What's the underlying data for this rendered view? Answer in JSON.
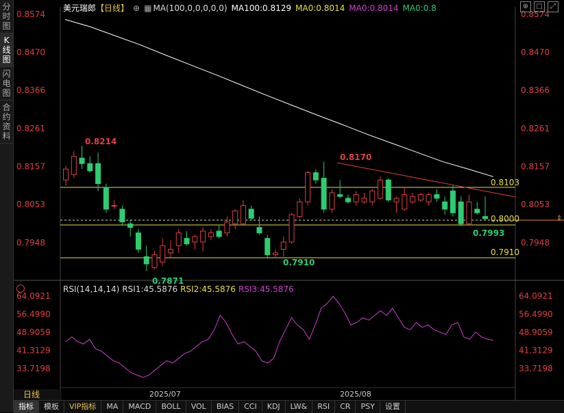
{
  "sidebar": {
    "tabs": [
      {
        "label": "分时图",
        "active": false
      },
      {
        "label": "K线图",
        "active": true
      },
      {
        "label": "闪电图",
        "active": false
      },
      {
        "label": "合约资料",
        "active": false
      }
    ]
  },
  "header": {
    "symbol": "美元瑞郎",
    "period": "【日线】",
    "add_icon": "⊕",
    "ma_settings": "MA(100,0,0,0,0,0)",
    "ma100": "MA100:0.8129",
    "ma0_a": "MA0:0.8014",
    "ma0_b": "MA0:0.8014",
    "ma0_c": "MA0:0.8"
  },
  "colors": {
    "up": "#e04040",
    "down": "#2ecc71",
    "yellow": "#e8e040",
    "magenta": "#d040d0",
    "white": "#ffffff",
    "axis": "#e04040"
  },
  "price_axis": {
    "labels": [
      "0.8574",
      "0.8470",
      "0.8366",
      "0.8261",
      "0.8157",
      "0.8053",
      "0.7948"
    ],
    "values": [
      0.8574,
      0.847,
      0.8366,
      0.8261,
      0.8157,
      0.8053,
      0.7948
    ]
  },
  "annotations": {
    "high1": "0.8214",
    "high2": "0.8170",
    "low1": "0.7871",
    "low2": "0.7910",
    "low3": "0.7993",
    "level_8103": "0.8103",
    "level_8000": "0.8000",
    "level_7910": "0.7910"
  },
  "x_axis": {
    "labels": [
      "2025/07",
      "2025/08"
    ]
  },
  "rsi": {
    "header": "RSI(14,14,14)",
    "rsi1": "RSI1:45.5876",
    "rsi2": "RSI2:45.5876",
    "rsi3": "RSI3:45.5876",
    "axis_labels": [
      "64.0921",
      "56.4990",
      "48.9059",
      "41.3129",
      "33.7198"
    ],
    "axis_values": [
      64.0921,
      56.499,
      48.9059,
      41.3129,
      33.7198
    ]
  },
  "bottom_bar": {
    "period": "日线",
    "tabs": [
      "指标",
      "模板",
      "VIP指标",
      "MA",
      "MACD",
      "BOLL",
      "VOL",
      "BIAS",
      "CCI",
      "KDJ",
      "LW&",
      "RSI",
      "CR",
      "PSY",
      "设置"
    ]
  },
  "chart_data": {
    "type": "candlestick",
    "ylim": [
      0.7871,
      0.8574
    ],
    "candles": [
      {
        "o": 0.812,
        "h": 0.816,
        "l": 0.8105,
        "c": 0.815
      },
      {
        "o": 0.8135,
        "h": 0.82,
        "l": 0.8125,
        "c": 0.8185
      },
      {
        "o": 0.818,
        "h": 0.8214,
        "l": 0.815,
        "c": 0.8165
      },
      {
        "o": 0.8165,
        "h": 0.8185,
        "l": 0.814,
        "c": 0.8145
      },
      {
        "o": 0.8165,
        "h": 0.8195,
        "l": 0.809,
        "c": 0.811
      },
      {
        "o": 0.81,
        "h": 0.811,
        "l": 0.803,
        "c": 0.804
      },
      {
        "o": 0.805,
        "h": 0.8065,
        "l": 0.804,
        "c": 0.805
      },
      {
        "o": 0.804,
        "h": 0.805,
        "l": 0.7995,
        "c": 0.8005
      },
      {
        "o": 0.8,
        "h": 0.801,
        "l": 0.7965,
        "c": 0.799
      },
      {
        "o": 0.7975,
        "h": 0.7985,
        "l": 0.792,
        "c": 0.793
      },
      {
        "o": 0.791,
        "h": 0.794,
        "l": 0.7871,
        "c": 0.789
      },
      {
        "o": 0.788,
        "h": 0.7925,
        "l": 0.7875,
        "c": 0.7915
      },
      {
        "o": 0.7895,
        "h": 0.796,
        "l": 0.7885,
        "c": 0.794
      },
      {
        "o": 0.792,
        "h": 0.7955,
        "l": 0.7905,
        "c": 0.793
      },
      {
        "o": 0.794,
        "h": 0.7985,
        "l": 0.792,
        "c": 0.7975
      },
      {
        "o": 0.796,
        "h": 0.798,
        "l": 0.794,
        "c": 0.7945
      },
      {
        "o": 0.795,
        "h": 0.797,
        "l": 0.793,
        "c": 0.7965
      },
      {
        "o": 0.795,
        "h": 0.799,
        "l": 0.7925,
        "c": 0.798
      },
      {
        "o": 0.7965,
        "h": 0.7985,
        "l": 0.7955,
        "c": 0.7975
      },
      {
        "o": 0.798,
        "h": 0.7995,
        "l": 0.796,
        "c": 0.7965
      },
      {
        "o": 0.7975,
        "h": 0.802,
        "l": 0.7965,
        "c": 0.8005
      },
      {
        "o": 0.8,
        "h": 0.804,
        "l": 0.7985,
        "c": 0.8035
      },
      {
        "o": 0.8,
        "h": 0.8065,
        "l": 0.7995,
        "c": 0.805
      },
      {
        "o": 0.804,
        "h": 0.805,
        "l": 0.801,
        "c": 0.8015
      },
      {
        "o": 0.799,
        "h": 0.802,
        "l": 0.797,
        "c": 0.7975
      },
      {
        "o": 0.796,
        "h": 0.797,
        "l": 0.7905,
        "c": 0.7915
      },
      {
        "o": 0.7915,
        "h": 0.793,
        "l": 0.7905,
        "c": 0.792
      },
      {
        "o": 0.793,
        "h": 0.7965,
        "l": 0.791,
        "c": 0.795
      },
      {
        "o": 0.795,
        "h": 0.803,
        "l": 0.7945,
        "c": 0.8025
      },
      {
        "o": 0.802,
        "h": 0.807,
        "l": 0.8015,
        "c": 0.806
      },
      {
        "o": 0.806,
        "h": 0.8145,
        "l": 0.805,
        "c": 0.814
      },
      {
        "o": 0.814,
        "h": 0.815,
        "l": 0.811,
        "c": 0.812
      },
      {
        "o": 0.8125,
        "h": 0.817,
        "l": 0.803,
        "c": 0.804
      },
      {
        "o": 0.804,
        "h": 0.8095,
        "l": 0.803,
        "c": 0.8085
      },
      {
        "o": 0.808,
        "h": 0.812,
        "l": 0.807,
        "c": 0.8075
      },
      {
        "o": 0.807,
        "h": 0.808,
        "l": 0.8055,
        "c": 0.806
      },
      {
        "o": 0.806,
        "h": 0.809,
        "l": 0.805,
        "c": 0.808
      },
      {
        "o": 0.806,
        "h": 0.8085,
        "l": 0.8055,
        "c": 0.807
      },
      {
        "o": 0.806,
        "h": 0.8095,
        "l": 0.805,
        "c": 0.809
      },
      {
        "o": 0.807,
        "h": 0.813,
        "l": 0.8065,
        "c": 0.812
      },
      {
        "o": 0.812,
        "h": 0.8125,
        "l": 0.806,
        "c": 0.8065
      },
      {
        "o": 0.806,
        "h": 0.8075,
        "l": 0.803,
        "c": 0.807
      },
      {
        "o": 0.804,
        "h": 0.81,
        "l": 0.8035,
        "c": 0.808
      },
      {
        "o": 0.806,
        "h": 0.8085,
        "l": 0.8055,
        "c": 0.8075
      },
      {
        "o": 0.8065,
        "h": 0.8085,
        "l": 0.806,
        "c": 0.808
      },
      {
        "o": 0.806,
        "h": 0.8085,
        "l": 0.805,
        "c": 0.808
      },
      {
        "o": 0.808,
        "h": 0.8095,
        "l": 0.806,
        "c": 0.807
      },
      {
        "o": 0.806,
        "h": 0.8075,
        "l": 0.8025,
        "c": 0.804
      },
      {
        "o": 0.809,
        "h": 0.8105,
        "l": 0.802,
        "c": 0.803
      },
      {
        "o": 0.806,
        "h": 0.8075,
        "l": 0.7993,
        "c": 0.8
      },
      {
        "o": 0.8,
        "h": 0.808,
        "l": 0.7995,
        "c": 0.806
      },
      {
        "o": 0.804,
        "h": 0.806,
        "l": 0.8025,
        "c": 0.803
      },
      {
        "o": 0.802,
        "h": 0.8075,
        "l": 0.801,
        "c": 0.8014
      }
    ],
    "ma100": [
      0.856,
      0.854,
      0.8515,
      0.849,
      0.8462,
      0.8435,
      0.8408,
      0.838,
      0.8352,
      0.8325,
      0.8298,
      0.8272,
      0.8245,
      0.822,
      0.8195,
      0.817,
      0.815,
      0.8129
    ],
    "rsi_series": [
      45,
      47,
      45,
      44,
      46,
      42,
      41,
      39,
      37,
      36,
      34,
      32,
      31,
      30,
      31,
      33,
      35,
      37,
      36,
      38,
      40,
      41,
      43,
      45,
      46,
      50,
      56,
      53,
      48,
      44,
      45,
      43,
      41,
      37,
      36,
      38,
      45,
      50,
      55,
      52,
      50,
      46,
      52,
      59,
      61,
      64,
      61,
      57,
      52,
      53,
      55,
      54,
      56,
      58,
      56,
      59,
      55,
      51,
      50,
      53,
      51,
      52,
      50,
      49,
      48,
      52,
      53,
      47,
      46,
      49,
      47,
      46,
      45.5876
    ],
    "trendline": {
      "from": 0.817,
      "to": 0.8085
    },
    "levels": [
      0.8103,
      0.8,
      0.791
    ]
  }
}
